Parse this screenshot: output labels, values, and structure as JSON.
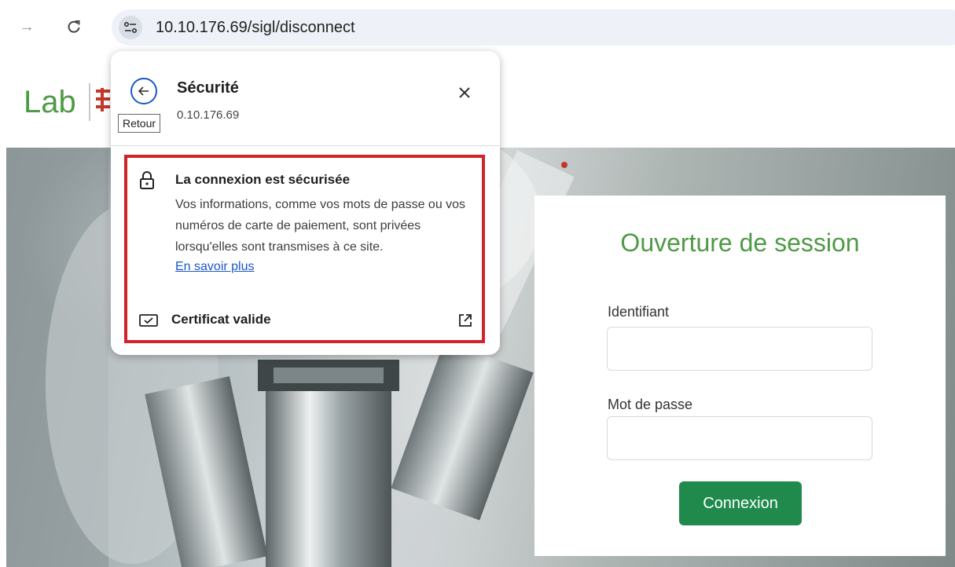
{
  "browser": {
    "url": "10.10.176.69/sigl/disconnect",
    "forward_icon": "arrow-right-icon",
    "reload_icon": "reload-icon",
    "site_info_icon": "tune-icon"
  },
  "page": {
    "logo_text": "Lab",
    "login": {
      "title": "Ouverture de session",
      "username_label": "Identifiant",
      "username_value": "",
      "password_label": "Mot de passe",
      "password_value": "",
      "submit_label": "Connexion"
    }
  },
  "popup": {
    "title": "Sécurité",
    "host": "0.10.176.69",
    "back_tooltip": "Retour",
    "connection_title": "La connexion est sécurisée",
    "connection_description": "Vos informations, comme vos mots de passe ou vos numéros de carte de paiement, sont privées lorsqu'elles sont transmises à ce site.",
    "learn_more": "En savoir plus",
    "certificate_label": "Certificat valide",
    "highlight_color": "#d3232a",
    "accent_color": "#1a57c9"
  },
  "colors": {
    "brand_green": "#4e9a45",
    "button_green": "#1f8a4c"
  }
}
